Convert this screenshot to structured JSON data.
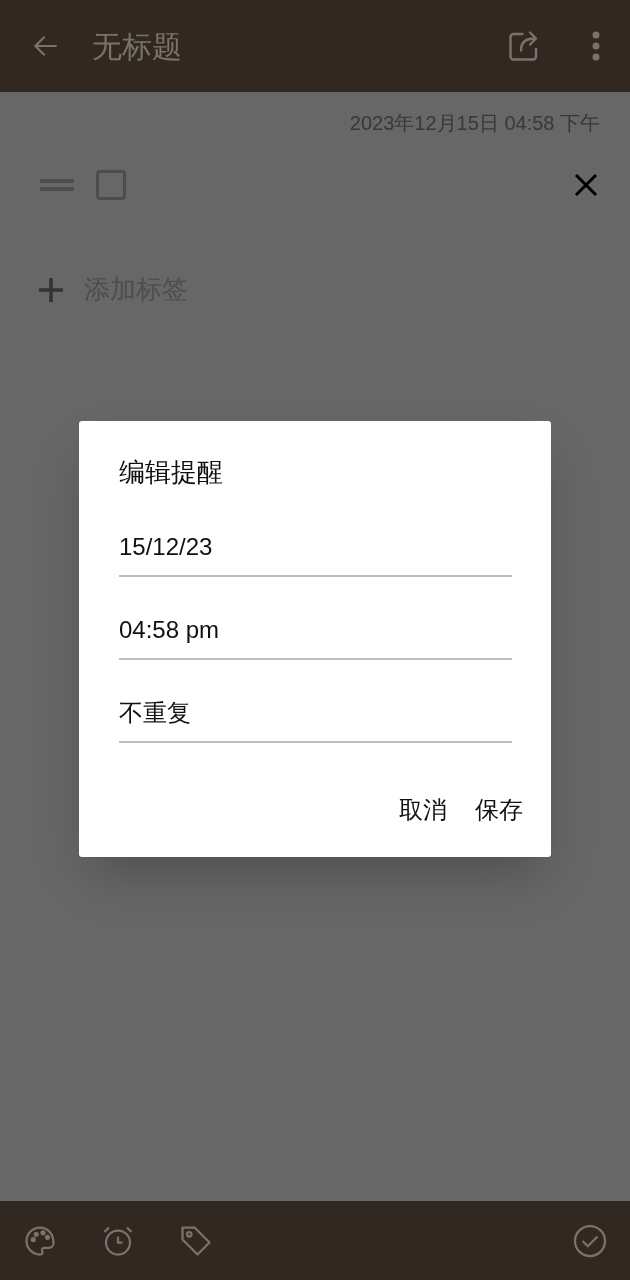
{
  "app_bar": {
    "title": "无标题"
  },
  "note": {
    "timestamp": "2023年12月15日 04:58 下午",
    "checklist_item": {
      "checked": false
    },
    "add_tag": "添加标签"
  },
  "dialog": {
    "title": "编辑提醒",
    "fields": [
      "15/12/23",
      "04:58 pm",
      "不重复"
    ],
    "buttons": [
      "取消",
      "保存"
    ]
  }
}
